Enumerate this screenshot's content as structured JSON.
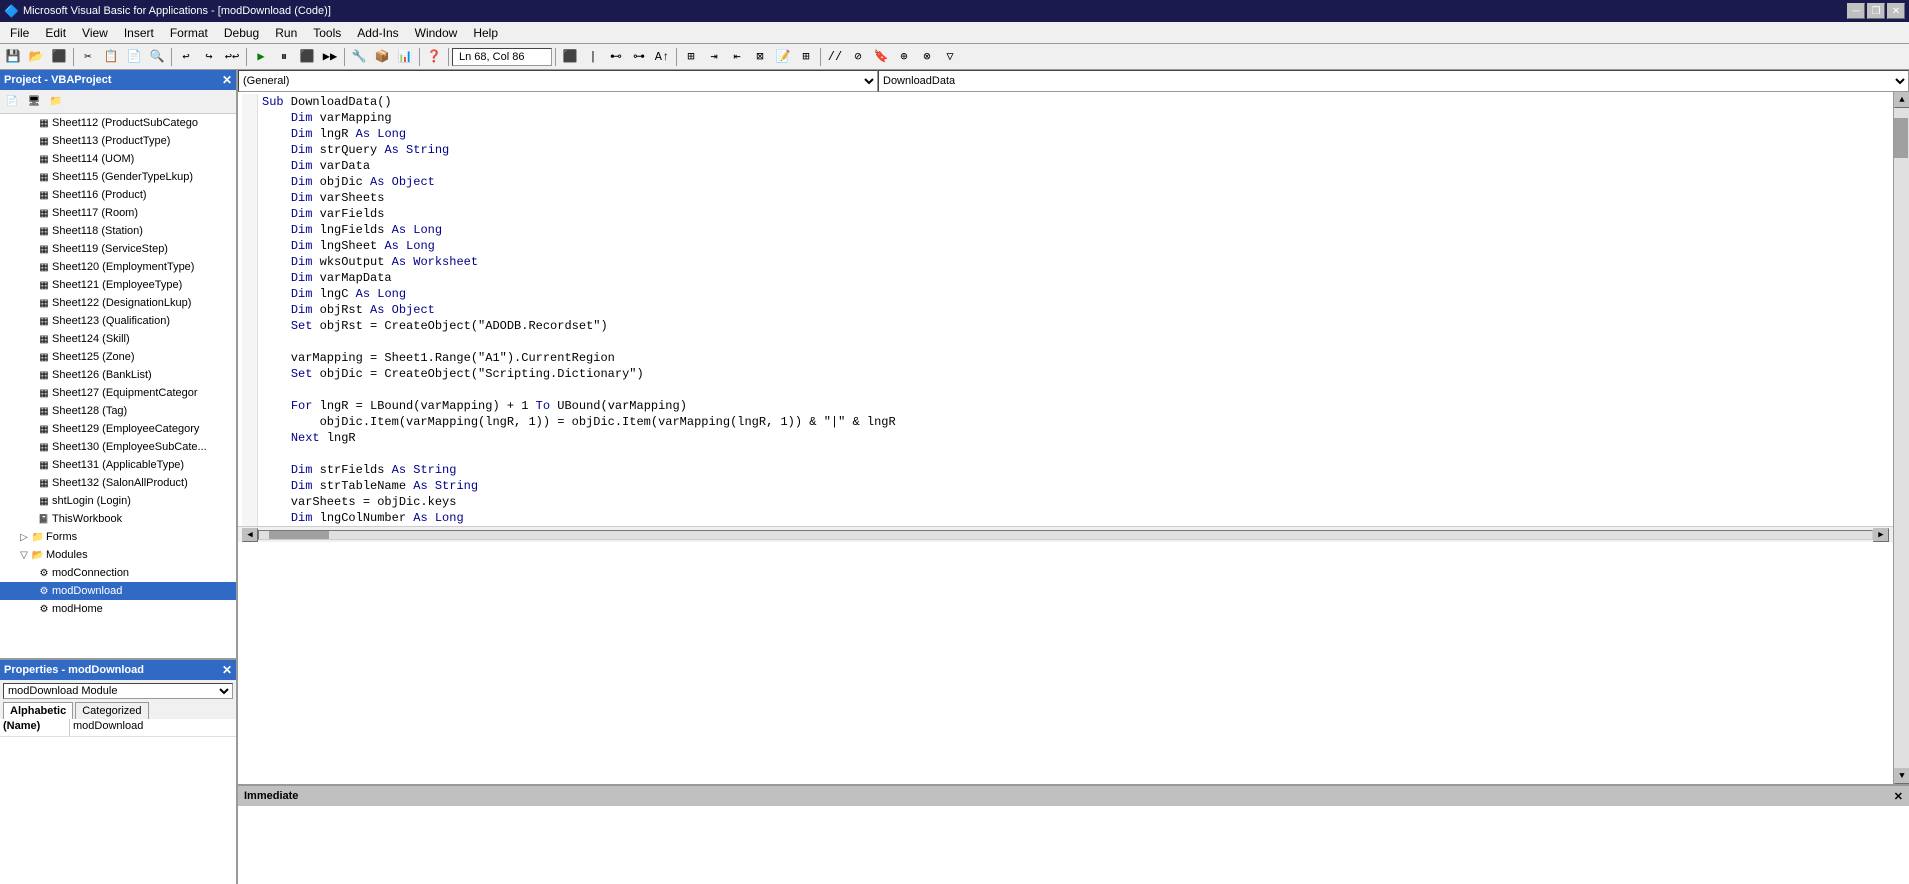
{
  "titleBar": {
    "title": "Microsoft Visual Basic for Applications - [modDownload (Code)]",
    "appIcon": "vba-icon"
  },
  "menuBar": {
    "items": [
      "File",
      "Edit",
      "View",
      "Insert",
      "Format",
      "Debug",
      "Run",
      "Tools",
      "Add-Ins",
      "Window",
      "Help"
    ]
  },
  "toolbar": {
    "statusText": "Ln 68, Col 86"
  },
  "projectPanel": {
    "title": "Project - VBAProject",
    "treeItems": [
      {
        "label": "Sheet112 (ProductSubCatego",
        "indent": 3,
        "icon": "sheet"
      },
      {
        "label": "Sheet113 (ProductType)",
        "indent": 3,
        "icon": "sheet"
      },
      {
        "label": "Sheet114 (UOM)",
        "indent": 3,
        "icon": "sheet"
      },
      {
        "label": "Sheet115 (GenderTypeLkup)",
        "indent": 3,
        "icon": "sheet"
      },
      {
        "label": "Sheet116 (Product)",
        "indent": 3,
        "icon": "sheet"
      },
      {
        "label": "Sheet117 (Room)",
        "indent": 3,
        "icon": "sheet"
      },
      {
        "label": "Sheet118 (Station)",
        "indent": 3,
        "icon": "sheet"
      },
      {
        "label": "Sheet119 (ServiceStep)",
        "indent": 3,
        "icon": "sheet"
      },
      {
        "label": "Sheet120 (EmploymentType)",
        "indent": 3,
        "icon": "sheet"
      },
      {
        "label": "Sheet121 (EmployeeType)",
        "indent": 3,
        "icon": "sheet"
      },
      {
        "label": "Sheet122 (DesignationLkup)",
        "indent": 3,
        "icon": "sheet"
      },
      {
        "label": "Sheet123 (Qualification)",
        "indent": 3,
        "icon": "sheet"
      },
      {
        "label": "Sheet124 (Skill)",
        "indent": 3,
        "icon": "sheet"
      },
      {
        "label": "Sheet125 (Zone)",
        "indent": 3,
        "icon": "sheet"
      },
      {
        "label": "Sheet126 (BankList)",
        "indent": 3,
        "icon": "sheet"
      },
      {
        "label": "Sheet127 (EquipmentCategor",
        "indent": 3,
        "icon": "sheet"
      },
      {
        "label": "Sheet128 (Tag)",
        "indent": 3,
        "icon": "sheet"
      },
      {
        "label": "Sheet129 (EmployeeCategory",
        "indent": 3,
        "icon": "sheet"
      },
      {
        "label": "Sheet130 (EmployeeSubCate...",
        "indent": 3,
        "icon": "sheet"
      },
      {
        "label": "Sheet131 (ApplicableType)",
        "indent": 3,
        "icon": "sheet"
      },
      {
        "label": "Sheet132 (SalonAllProduct)",
        "indent": 3,
        "icon": "sheet"
      },
      {
        "label": "shtLogin (Login)",
        "indent": 3,
        "icon": "sheet"
      },
      {
        "label": "ThisWorkbook",
        "indent": 3,
        "icon": "workbook"
      },
      {
        "label": "Forms",
        "indent": 2,
        "icon": "folder",
        "expand": true
      },
      {
        "label": "Modules",
        "indent": 2,
        "icon": "folder-open",
        "expand": true,
        "expanded": true
      },
      {
        "label": "modConnection",
        "indent": 3,
        "icon": "module"
      },
      {
        "label": "modDownload",
        "indent": 3,
        "icon": "module",
        "selected": true
      },
      {
        "label": "modHome",
        "indent": 3,
        "icon": "module"
      }
    ]
  },
  "propertiesPanel": {
    "title": "Properties - modDownload",
    "objectName": "modDownload  Module",
    "tabs": [
      "Alphabetic",
      "Categorized"
    ],
    "activeTab": "Alphabetic",
    "properties": [
      {
        "key": "(Name)",
        "value": "modDownload"
      }
    ]
  },
  "codePanel": {
    "generalDropdown": "(General)",
    "subDropdown": "DownloadData",
    "lines": [
      {
        "indent": 0,
        "tokens": [
          {
            "type": "kw",
            "text": "Sub"
          },
          {
            "type": "normal",
            "text": " DownloadData()"
          }
        ]
      },
      {
        "indent": 4,
        "tokens": [
          {
            "type": "kw",
            "text": "Dim"
          },
          {
            "type": "normal",
            "text": " varMapping"
          }
        ]
      },
      {
        "indent": 4,
        "tokens": [
          {
            "type": "kw",
            "text": "Dim"
          },
          {
            "type": "normal",
            "text": " lngR "
          },
          {
            "type": "kw",
            "text": "As"
          },
          {
            "type": "normal",
            "text": " "
          },
          {
            "type": "kw",
            "text": "Long"
          }
        ]
      },
      {
        "indent": 4,
        "tokens": [
          {
            "type": "kw",
            "text": "Dim"
          },
          {
            "type": "normal",
            "text": " strQuery "
          },
          {
            "type": "kw",
            "text": "As"
          },
          {
            "type": "normal",
            "text": " "
          },
          {
            "type": "kw",
            "text": "String"
          }
        ]
      },
      {
        "indent": 4,
        "tokens": [
          {
            "type": "kw",
            "text": "Dim"
          },
          {
            "type": "normal",
            "text": " varData"
          }
        ]
      },
      {
        "indent": 4,
        "tokens": [
          {
            "type": "kw",
            "text": "Dim"
          },
          {
            "type": "normal",
            "text": " objDic "
          },
          {
            "type": "kw",
            "text": "As"
          },
          {
            "type": "normal",
            "text": " "
          },
          {
            "type": "kw",
            "text": "Object"
          }
        ]
      },
      {
        "indent": 4,
        "tokens": [
          {
            "type": "kw",
            "text": "Dim"
          },
          {
            "type": "normal",
            "text": " varSheets"
          }
        ]
      },
      {
        "indent": 4,
        "tokens": [
          {
            "type": "kw",
            "text": "Dim"
          },
          {
            "type": "normal",
            "text": " varFields"
          }
        ]
      },
      {
        "indent": 4,
        "tokens": [
          {
            "type": "kw",
            "text": "Dim"
          },
          {
            "type": "normal",
            "text": " lngFields "
          },
          {
            "type": "kw",
            "text": "As"
          },
          {
            "type": "normal",
            "text": " "
          },
          {
            "type": "kw",
            "text": "Long"
          }
        ]
      },
      {
        "indent": 4,
        "tokens": [
          {
            "type": "kw",
            "text": "Dim"
          },
          {
            "type": "normal",
            "text": " lngSheet "
          },
          {
            "type": "kw",
            "text": "As"
          },
          {
            "type": "normal",
            "text": " "
          },
          {
            "type": "kw",
            "text": "Long"
          }
        ]
      },
      {
        "indent": 4,
        "tokens": [
          {
            "type": "kw",
            "text": "Dim"
          },
          {
            "type": "normal",
            "text": " wksOutput "
          },
          {
            "type": "kw",
            "text": "As"
          },
          {
            "type": "normal",
            "text": " "
          },
          {
            "type": "kw",
            "text": "Worksheet"
          }
        ]
      },
      {
        "indent": 4,
        "tokens": [
          {
            "type": "kw",
            "text": "Dim"
          },
          {
            "type": "normal",
            "text": " varMapData"
          }
        ]
      },
      {
        "indent": 4,
        "tokens": [
          {
            "type": "kw",
            "text": "Dim"
          },
          {
            "type": "normal",
            "text": " lngC "
          },
          {
            "type": "kw",
            "text": "As"
          },
          {
            "type": "normal",
            "text": " "
          },
          {
            "type": "kw",
            "text": "Long"
          }
        ]
      },
      {
        "indent": 4,
        "tokens": [
          {
            "type": "kw",
            "text": "Dim"
          },
          {
            "type": "normal",
            "text": " objRst "
          },
          {
            "type": "kw",
            "text": "As"
          },
          {
            "type": "normal",
            "text": " "
          },
          {
            "type": "kw",
            "text": "Object"
          }
        ]
      },
      {
        "indent": 4,
        "tokens": [
          {
            "type": "kw",
            "text": "Set"
          },
          {
            "type": "normal",
            "text": " objRst = CreateObject(\"ADODB.Recordset\")"
          }
        ]
      },
      {
        "indent": 0,
        "tokens": []
      },
      {
        "indent": 4,
        "tokens": [
          {
            "type": "normal",
            "text": "varMapping = Sheet1.Range(\"A1\").CurrentRegion"
          }
        ]
      },
      {
        "indent": 4,
        "tokens": [
          {
            "type": "kw",
            "text": "Set"
          },
          {
            "type": "normal",
            "text": " objDic = CreateObject(\"Scripting.Dictionary\")"
          }
        ]
      },
      {
        "indent": 0,
        "tokens": []
      },
      {
        "indent": 4,
        "tokens": [
          {
            "type": "kw",
            "text": "For"
          },
          {
            "type": "normal",
            "text": " lngR = LBound(varMapping) + 1 "
          },
          {
            "type": "kw",
            "text": "To"
          },
          {
            "type": "normal",
            "text": " UBound(varMapping)"
          }
        ]
      },
      {
        "indent": 8,
        "tokens": [
          {
            "type": "normal",
            "text": "objDic.Item(varMapping(lngR, 1)) = objDic.Item(varMapping(lngR, 1)) & \"|\" & lngR"
          }
        ]
      },
      {
        "indent": 4,
        "tokens": [
          {
            "type": "kw",
            "text": "Next"
          },
          {
            "type": "normal",
            "text": " lngR"
          }
        ]
      },
      {
        "indent": 0,
        "tokens": []
      },
      {
        "indent": 4,
        "tokens": [
          {
            "type": "kw",
            "text": "Dim"
          },
          {
            "type": "normal",
            "text": " strFields "
          },
          {
            "type": "kw",
            "text": "As"
          },
          {
            "type": "normal",
            "text": " "
          },
          {
            "type": "kw",
            "text": "String"
          }
        ]
      },
      {
        "indent": 4,
        "tokens": [
          {
            "type": "kw",
            "text": "Dim"
          },
          {
            "type": "normal",
            "text": " strTableName "
          },
          {
            "type": "kw",
            "text": "As"
          },
          {
            "type": "normal",
            "text": " "
          },
          {
            "type": "kw",
            "text": "String"
          }
        ]
      },
      {
        "indent": 4,
        "tokens": [
          {
            "type": "normal",
            "text": "varSheets = objDic.keys"
          }
        ]
      },
      {
        "indent": 4,
        "tokens": [
          {
            "type": "kw",
            "text": "Dim"
          },
          {
            "type": "normal",
            "text": " lngColNumber "
          },
          {
            "type": "kw",
            "text": "As"
          },
          {
            "type": "normal",
            "text": " "
          },
          {
            "type": "kw",
            "text": "Long"
          }
        ]
      }
    ]
  },
  "immediatePanel": {
    "title": "Immediate",
    "content": ""
  },
  "icons": {
    "sheet": "▦",
    "workbook": "📓",
    "folder": "📁",
    "module": "⚙",
    "close": "✕",
    "minimize": "─",
    "maximize": "□",
    "restore": "❐"
  }
}
